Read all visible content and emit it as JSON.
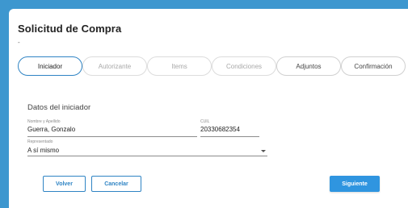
{
  "page": {
    "title": "Solicitud de Compra",
    "subtitle": "-"
  },
  "steps": [
    {
      "label": "Iniciador",
      "state": "active"
    },
    {
      "label": "Autorizante",
      "state": "disabled"
    },
    {
      "label": "Items",
      "state": "disabled"
    },
    {
      "label": "Condiciones",
      "state": "disabled"
    },
    {
      "label": "Adjuntos",
      "state": "done"
    },
    {
      "label": "Confirmación",
      "state": "done"
    }
  ],
  "form": {
    "section_title": "Datos del iniciador",
    "name": {
      "label": "Nombre y Apellido",
      "value": "Guerra, Gonzalo"
    },
    "cuil": {
      "label": "CUIL",
      "value": "20330682354"
    },
    "represented": {
      "label": "Representado",
      "value": "A sí mismo"
    }
  },
  "actions": {
    "back": "Volver",
    "cancel": "Cancelar",
    "next": "Siguiente"
  },
  "colors": {
    "accent": "#2f84c4",
    "primary_button": "#2f95e0",
    "background": "#3d97cf"
  }
}
